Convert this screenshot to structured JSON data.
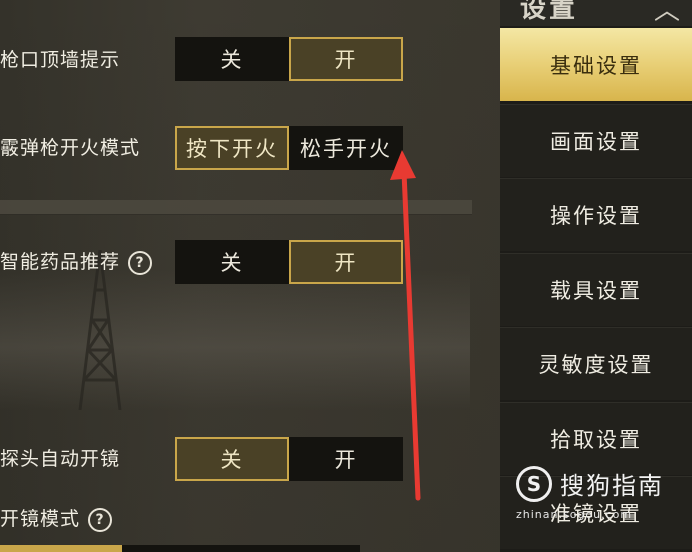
{
  "settings": {
    "muzzle_wall_hint": {
      "label": "枪口顶墙提示",
      "off": "关",
      "on": "开",
      "selected": "on"
    },
    "shotgun_fire_mode": {
      "label": "霰弹枪开火模式",
      "press": "按下开火",
      "release": "松手开火",
      "selected": "press"
    },
    "smart_medicine": {
      "label": "智能药品推荐",
      "help": "?",
      "off": "关",
      "on": "开",
      "selected": "on"
    },
    "peek_auto_scope": {
      "label": "探头自动开镜",
      "off": "关",
      "on": "开",
      "selected": "off"
    },
    "scope_mode": {
      "label": "开镜模式",
      "help": "?"
    }
  },
  "sidebar": {
    "title": "设置",
    "items": [
      {
        "label": "基础设置",
        "active": true
      },
      {
        "label": "画面设置",
        "active": false
      },
      {
        "label": "操作设置",
        "active": false
      },
      {
        "label": "载具设置",
        "active": false
      },
      {
        "label": "灵敏度设置",
        "active": false
      },
      {
        "label": "拾取设置",
        "active": false
      },
      {
        "label": "准镜设置",
        "active": false
      }
    ]
  },
  "watermark": {
    "main": "搜狗指南",
    "sub": "zhinan.sogou.com",
    "logo": "S"
  },
  "colors": {
    "accent": "#c9a64a",
    "arrow": "#e83a32",
    "sidebar_active": "#e8cf76"
  }
}
